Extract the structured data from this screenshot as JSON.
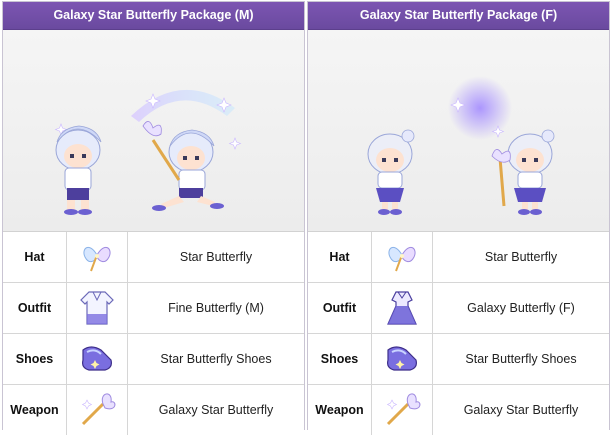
{
  "packages": [
    {
      "title": "Galaxy Star Butterfly Package (M)",
      "rows": [
        {
          "label": "Hat",
          "item": "Star Butterfly",
          "icon": "butterfly-hat-icon"
        },
        {
          "label": "Outfit",
          "item": "Fine Butterfly (M)",
          "icon": "shirt-outfit-icon"
        },
        {
          "label": "Shoes",
          "item": "Star Butterfly Shoes",
          "icon": "shoes-icon"
        },
        {
          "label": "Weapon",
          "item": "Galaxy Star Butterfly",
          "icon": "star-wand-icon"
        }
      ]
    },
    {
      "title": "Galaxy Star Butterfly Package (F)",
      "rows": [
        {
          "label": "Hat",
          "item": "Star Butterfly",
          "icon": "butterfly-hat-icon"
        },
        {
          "label": "Outfit",
          "item": "Galaxy Butterfly (F)",
          "icon": "dress-outfit-icon"
        },
        {
          "label": "Shoes",
          "item": "Star Butterfly Shoes",
          "icon": "shoes-icon"
        },
        {
          "label": "Weapon",
          "item": "Galaxy Star Butterfly",
          "icon": "star-wand-icon"
        }
      ]
    }
  ],
  "colors": {
    "header": "#6a4a9f",
    "accent_purple": "#7c5cd6",
    "hair": "#dfe3f7",
    "glow": "#c8b6ff"
  }
}
